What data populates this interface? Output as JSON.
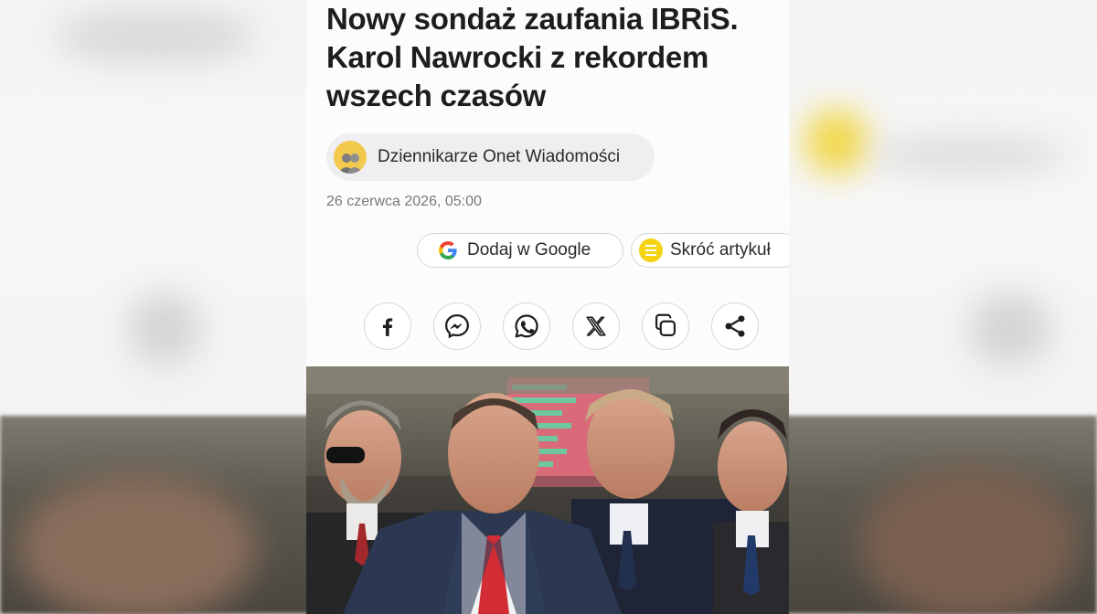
{
  "article": {
    "headline": "Nowy sondaż zaufania IBRiS. Karol Nawrocki z rekordem wszech czasów",
    "author": "Dziennikarze Onet Wiadomości",
    "date": "26 czerwca 2026, 05:00"
  },
  "actions": {
    "google_label": "Dodaj w Google",
    "shorten_label": "Skróć artykuł"
  },
  "share": {
    "icons": [
      "facebook-icon",
      "messenger-icon",
      "whatsapp-icon",
      "x-icon",
      "copy-icon",
      "share-icon"
    ]
  },
  "colors": {
    "accent_yellow": "#f5d313",
    "headline": "#1d1d1f",
    "chip_bg": "#efeef1"
  }
}
